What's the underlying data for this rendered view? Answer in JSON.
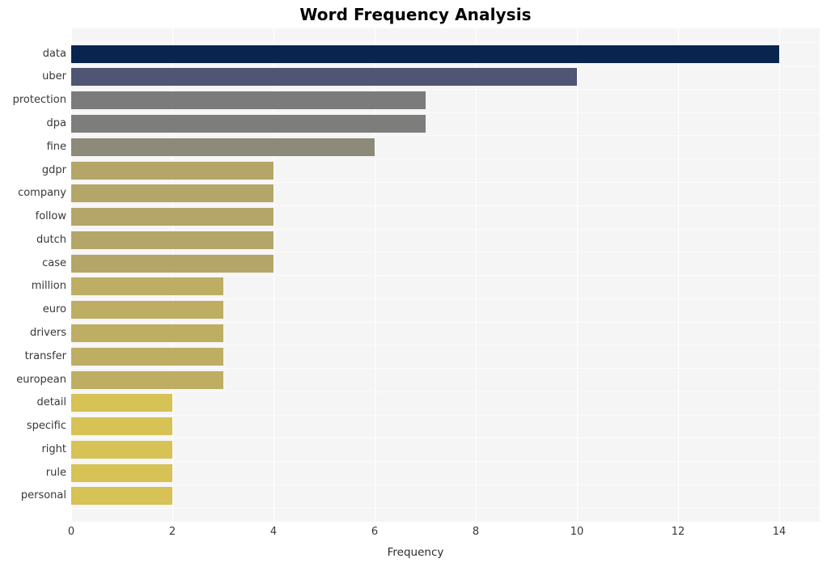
{
  "chart_data": {
    "type": "bar",
    "orientation": "horizontal",
    "title": "Word Frequency Analysis",
    "xlabel": "Frequency",
    "ylabel": "",
    "xlim": [
      0,
      14.8
    ],
    "xticks": [
      0,
      2,
      4,
      6,
      8,
      10,
      12,
      14
    ],
    "xtick_labels": [
      "0",
      "2",
      "4",
      "6",
      "8",
      "10",
      "12",
      "14"
    ],
    "grid": true,
    "grid_axis": "both",
    "legend": false,
    "categories": [
      "data",
      "uber",
      "protection",
      "dpa",
      "fine",
      "gdpr",
      "company",
      "follow",
      "dutch",
      "case",
      "million",
      "euro",
      "drivers",
      "transfer",
      "european",
      "detail",
      "specific",
      "right",
      "rule",
      "personal"
    ],
    "values": [
      14,
      10,
      7,
      7,
      6,
      4,
      4,
      4,
      4,
      4,
      3,
      3,
      3,
      3,
      3,
      2,
      2,
      2,
      2,
      2
    ],
    "bar_colors": [
      "#0a2450",
      "#4f5572",
      "#7b7b7b",
      "#7d7d7c",
      "#8d8a79",
      "#b3a668",
      "#b3a668",
      "#b3a668",
      "#b3a668",
      "#b3a668",
      "#bdae64",
      "#bdae64",
      "#bdae64",
      "#bdae64",
      "#bdae64",
      "#d6c255",
      "#d6c255",
      "#d6c255",
      "#d6c255",
      "#d6c255"
    ],
    "plot_background": "#f5f5f6",
    "figure_background": "#ffffff",
    "gridline_color": "#ffffff"
  }
}
